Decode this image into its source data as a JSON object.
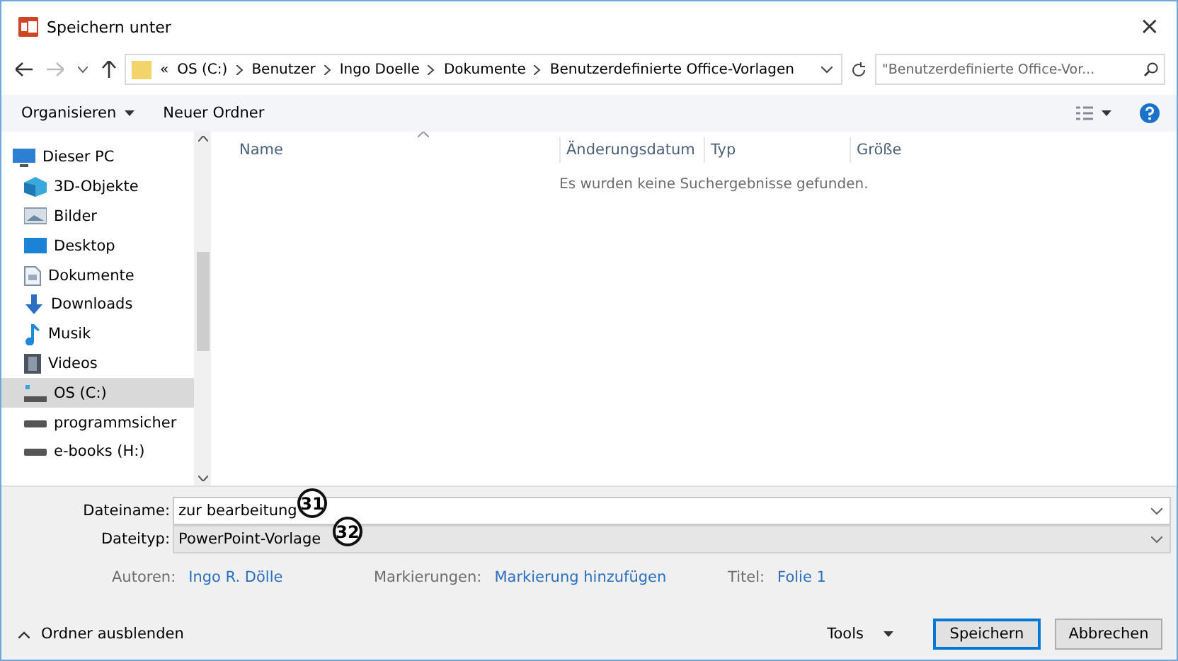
{
  "window": {
    "title": "Speichern unter",
    "close": "×"
  },
  "address": {
    "overflow": "«",
    "crumbs": [
      "OS (C:)",
      "Benutzer",
      "Ingo Doelle",
      "Dokumente",
      "Benutzerdefinierte Office-Vorlagen"
    ],
    "search_placeholder": "\"Benutzerdefinierte Office-Vor..."
  },
  "toolbar": {
    "organize": "Organisieren",
    "new_folder": "Neuer Ordner"
  },
  "sidebar": {
    "items": [
      {
        "label": "Dieser PC",
        "kind": "pc",
        "selected": false,
        "children": [
          {
            "label": "3D-Objekte",
            "kind": "cube",
            "selected": false
          },
          {
            "label": "Bilder",
            "kind": "pictures",
            "selected": false
          },
          {
            "label": "Desktop",
            "kind": "desktop",
            "selected": false
          },
          {
            "label": "Dokumente",
            "kind": "document",
            "selected": false
          },
          {
            "label": "Downloads",
            "kind": "download",
            "selected": false
          },
          {
            "label": "Musik",
            "kind": "music",
            "selected": false
          },
          {
            "label": "Videos",
            "kind": "video",
            "selected": false
          },
          {
            "label": "OS (C:)",
            "kind": "osdrive",
            "selected": true
          },
          {
            "label": "programmsicher",
            "kind": "drive",
            "selected": false
          },
          {
            "label": "e-books (H:)",
            "kind": "drive",
            "selected": false
          }
        ]
      }
    ]
  },
  "file_list": {
    "columns": [
      "Name",
      "Änderungsdatum",
      "Typ",
      "Größe"
    ],
    "empty_message": "Es wurden keine Suchergebnisse gefunden."
  },
  "save_panel": {
    "filename_label": "Dateiname:",
    "filename": "zur bearbeitung",
    "filetype_label": "Dateityp:",
    "filetype": "PowerPoint-Vorlage",
    "meta": [
      {
        "label": "Autoren:",
        "value": "Ingo R. Dölle"
      },
      {
        "label": "Markierungen:",
        "value": "Markierung hinzufügen"
      },
      {
        "label": "Titel:",
        "value": "Folie 1"
      }
    ]
  },
  "callouts": [
    "31",
    "32"
  ],
  "footer": {
    "hide_folders": "Ordner ausblenden",
    "tools": "Tools",
    "buttons": [
      {
        "label": "Speichern",
        "kind": "primary"
      },
      {
        "label": "Abbrechen",
        "kind": "normal"
      }
    ]
  }
}
